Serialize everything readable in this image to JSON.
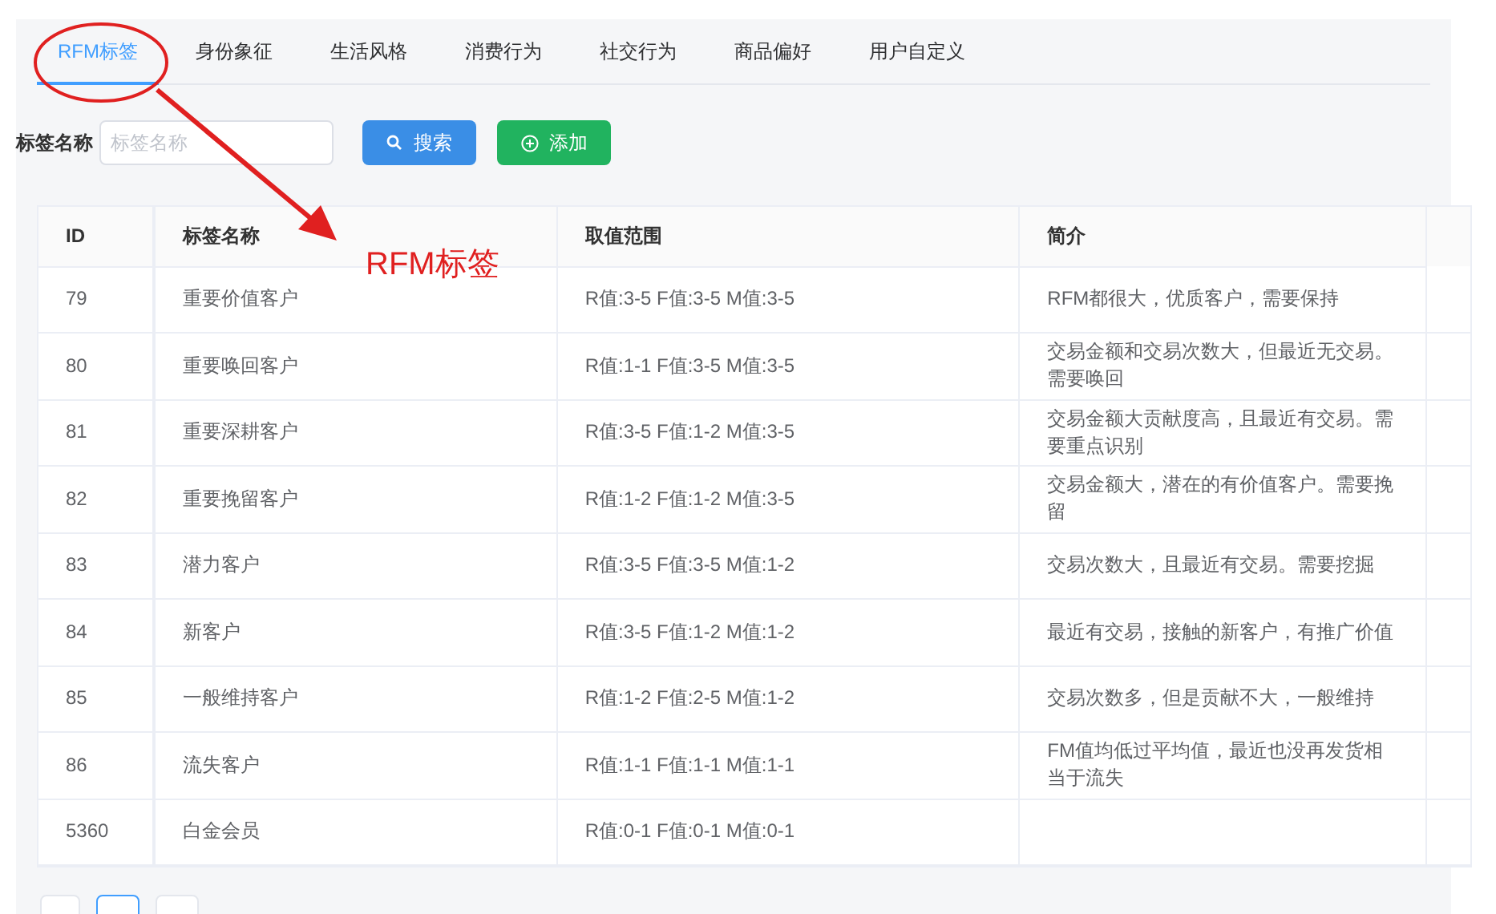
{
  "tabs": [
    {
      "label": "RFM标签",
      "selected": true
    },
    {
      "label": "身份象征",
      "selected": false
    },
    {
      "label": "生活风格",
      "selected": false
    },
    {
      "label": "消费行为",
      "selected": false
    },
    {
      "label": "社交行为",
      "selected": false
    },
    {
      "label": "商品偏好",
      "selected": false
    },
    {
      "label": "用户自定义",
      "selected": false
    }
  ],
  "search": {
    "label": "标签名称",
    "placeholder": "标签名称"
  },
  "buttons": [
    {
      "kind": "search",
      "label": "搜索"
    },
    {
      "kind": "add",
      "label": "添加"
    }
  ],
  "annotation": {
    "text": "RFM标签"
  },
  "table": {
    "columns": [
      "ID",
      "标签名称",
      "取值范围",
      "简介"
    ],
    "rows": [
      [
        "79",
        "重要价值客户",
        "R值:3-5 F值:3-5 M值:3-5",
        "RFM都很大，优质客户，需要保持"
      ],
      [
        "80",
        "重要唤回客户",
        "R值:1-1 F值:3-5 M值:3-5",
        "交易金额和交易次数大，但最近无交易。需要唤回"
      ],
      [
        "81",
        "重要深耕客户",
        "R值:3-5 F值:1-2 M值:3-5",
        "交易金额大贡献度高，且最近有交易。需要重点识别"
      ],
      [
        "82",
        "重要挽留客户",
        "R值:1-2 F值:1-2 M值:3-5",
        "交易金额大，潜在的有价值客户。需要挽留"
      ],
      [
        "83",
        "潜力客户",
        "R值:3-5 F值:3-5 M值:1-2",
        "交易次数大，且最近有交易。需要挖掘"
      ],
      [
        "84",
        "新客户",
        "R值:3-5 F值:1-2 M值:1-2",
        "最近有交易，接触的新客户，有推广价值"
      ],
      [
        "85",
        "一般维持客户",
        "R值:1-2 F值:2-5 M值:1-2",
        "交易次数多，但是贡献不大，一般维持"
      ],
      [
        "86",
        "流失客户",
        "R值:1-1 F值:1-1 M值:1-1",
        "FM值均低过平均值，最近也没再发货相当于流失"
      ],
      [
        "5360",
        "白金会员",
        "R值:0-1 F值:0-1 M值:0-1",
        ""
      ]
    ]
  }
}
